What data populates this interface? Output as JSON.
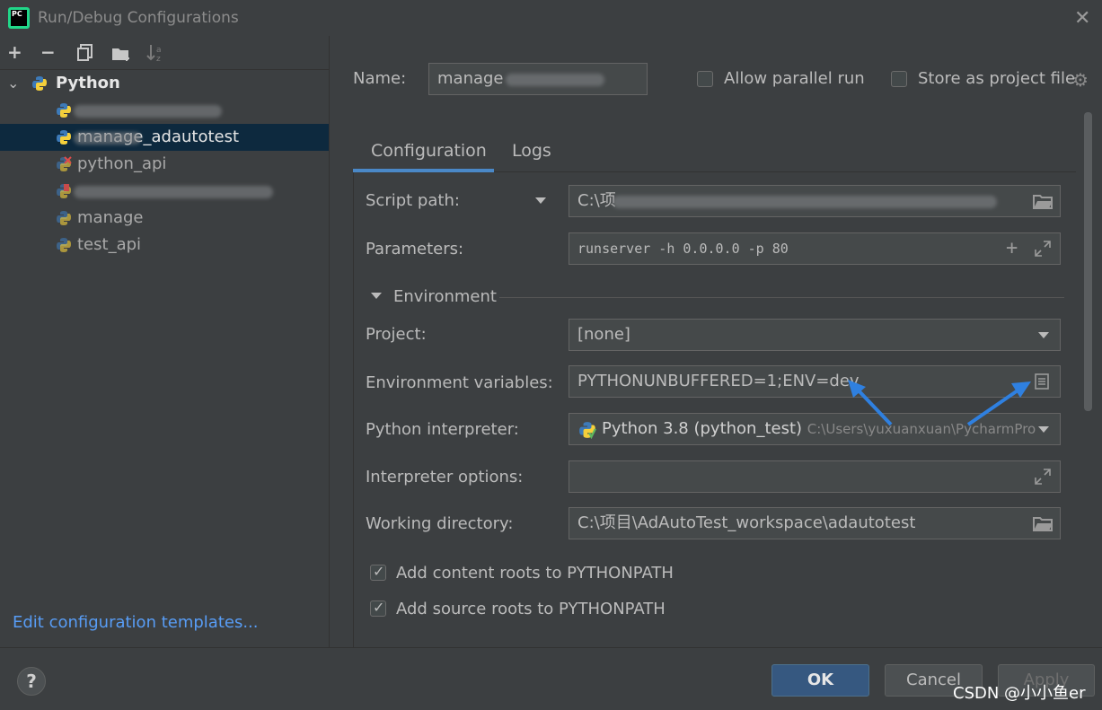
{
  "window": {
    "title": "Run/Debug Configurations",
    "app_badge": "PC"
  },
  "left": {
    "root_label": "Python",
    "items": [
      {
        "label": "",
        "selected": false
      },
      {
        "label": "manage_adautotest",
        "selected": true
      },
      {
        "label": "python_api",
        "selected": false
      },
      {
        "label": "",
        "selected": false
      },
      {
        "label": "manage",
        "selected": false
      },
      {
        "label": "test_api",
        "selected": false
      }
    ],
    "edit_templates_link": "Edit configuration templates..."
  },
  "header": {
    "name_label": "Name:",
    "name_value": "manage",
    "allow_parallel_label": "Allow parallel run",
    "store_project_label": "Store as project file"
  },
  "tabs": [
    {
      "label": "Configuration"
    },
    {
      "label": "Logs"
    }
  ],
  "config": {
    "script_path_label": "Script path:",
    "script_path_value": "C:\\项",
    "parameters_label": "Parameters:",
    "parameters_value": "runserver -h 0.0.0.0 -p 80",
    "environment_section": "Environment",
    "project_label": "Project:",
    "project_value": "[none]",
    "env_vars_label": "Environment variables:",
    "env_vars_value": "PYTHONUNBUFFERED=1;ENV=dev",
    "interpreter_label": "Python interpreter:",
    "interpreter_value": "Python 3.8 (python_test)",
    "interpreter_path": "C:\\Users\\yuxuanxuan\\PycharmPro",
    "interp_options_label": "Interpreter options:",
    "interp_options_value": "",
    "workdir_label": "Working directory:",
    "workdir_value": "C:\\项目\\AdAutoTest_workspace\\adautotest",
    "content_roots_label": "Add content roots to PYTHONPATH",
    "source_roots_label": "Add source roots to PYTHONPATH"
  },
  "footer": {
    "help_label": "?",
    "ok_label": "OK",
    "cancel_label": "Cancel",
    "apply_label": "Apply"
  },
  "watermark": "CSDN @小小鱼er",
  "colors": {
    "accent": "#4a88c7",
    "arrow": "#2f80e0",
    "selection": "#0d293e",
    "ok_button": "#365880"
  }
}
